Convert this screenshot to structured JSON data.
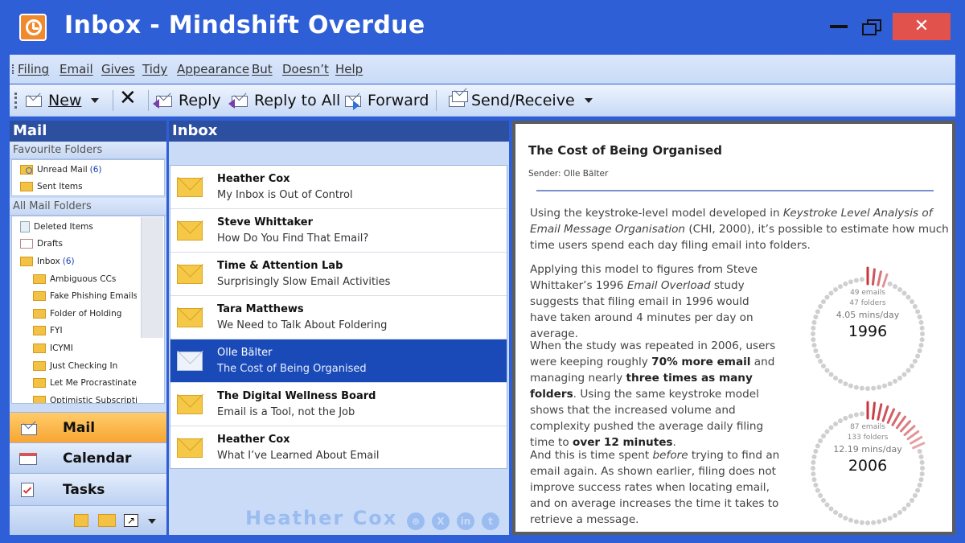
{
  "window": {
    "title": "Inbox - Mindshift Overdue",
    "close_glyph": "✕"
  },
  "menu": [
    "Filing",
    "Email",
    "Gives",
    "Tidy",
    "Appearance",
    "But",
    "Doesn’t",
    "Help"
  ],
  "toolbar": {
    "new": "New",
    "reply": "Reply",
    "reply_all": "Reply to All",
    "forward": "Forward",
    "send_receive": "Send/Receive"
  },
  "nav": {
    "header": "Mail",
    "favourites_header": "Favourite Folders",
    "favourites": [
      {
        "label": "Unread Mail",
        "count": "(6)"
      },
      {
        "label": "Sent Items",
        "count": ""
      }
    ],
    "all_header": "All Mail Folders",
    "folders": [
      {
        "label": "Deleted Items",
        "count": ""
      },
      {
        "label": "Drafts",
        "count": ""
      },
      {
        "label": "Inbox",
        "count": "(6)"
      },
      {
        "label": "Ambiguous CCs",
        "count": ""
      },
      {
        "label": "Fake Phishing Emails",
        "count": ""
      },
      {
        "label": "Folder of Holding",
        "count": ""
      },
      {
        "label": "FYI",
        "count": ""
      },
      {
        "label": "ICYMI",
        "count": ""
      },
      {
        "label": "Just Checking In",
        "count": ""
      },
      {
        "label": "Let Me Procrastinate",
        "count": ""
      },
      {
        "label": "Optimistic Subscriptions",
        "count": ""
      }
    ],
    "buttons": [
      "Mail",
      "Calendar",
      "Tasks"
    ]
  },
  "inbox": {
    "header": "Inbox",
    "messages": [
      {
        "sender": "Heather Cox",
        "subject": "My Inbox is Out of Control"
      },
      {
        "sender": "Steve Whittaker",
        "subject": "How Do You Find That Email?"
      },
      {
        "sender": "Time & Attention Lab",
        "subject": "Surprisingly Slow Email Activities"
      },
      {
        "sender": "Tara Matthews",
        "subject": "We Need to Talk About Foldering"
      },
      {
        "sender": "Olle Bälter",
        "subject": "The Cost of Being Organised"
      },
      {
        "sender": "The Digital Wellness Board",
        "subject": "Email is a Tool, not the Job"
      },
      {
        "sender": "Heather Cox",
        "subject": "What I’ve Learned About Email"
      }
    ],
    "signature": "Heather Cox"
  },
  "reading": {
    "title": "The Cost of Being Organised",
    "sender": "Sender: Olle Bälter",
    "p1": [
      "Using the keystroke-level model developed in ",
      "Keystroke Level Analysis of Email Message Organisation",
      " (CHI, 2000), it’s possible to estimate how much time users spend each day filing email into folders."
    ],
    "p2": [
      "Applying this model to figures from Steve Whittaker’s 1996 ",
      "Email Overload",
      " study suggests that filing email in 1996 would have taken around 4 minutes per day on average."
    ],
    "p3": [
      "When the study was repeated in 2006, users were keeping roughly ",
      "70% more email",
      " and managing nearly ",
      "three times as many folders",
      ". Using the same keystroke model shows that the increased volume and complexity pushed the average daily filing time to ",
      "over 12 minutes",
      "."
    ],
    "p4": [
      "And this is time spent ",
      "before",
      " trying to find an email again. As shown earlier, filing does not improve success rates when locating email, and on average increases the time it takes to retrieve a message."
    ],
    "rings": [
      {
        "emails": "49 emails",
        "folders": "47 folders",
        "rate": "4.05 mins/day",
        "year": "1996",
        "minutes": 4.05
      },
      {
        "emails": "87 emails",
        "folders": "133 folders",
        "rate": "12.19 mins/day",
        "year": "2006",
        "minutes": 12.19
      }
    ],
    "colors": {
      "dot": "#cfcfcf",
      "accent": "#c8343c"
    }
  }
}
